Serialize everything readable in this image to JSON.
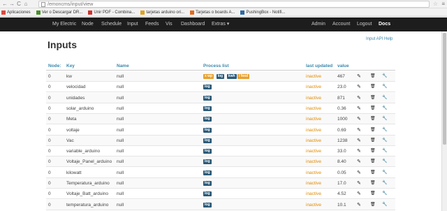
{
  "browser": {
    "url": "/emoncms/input/view",
    "bookmarks": [
      {
        "label": "Aplicaciones",
        "color": "#e5473c"
      },
      {
        "label": "Ver o Descargar DR...",
        "color": "#4a8f2a"
      },
      {
        "label": "Unir PDF - Combina...",
        "color": "#d1332e"
      },
      {
        "label": "tarjetas arduino ori...",
        "color": "#e0a21f"
      },
      {
        "label": "Tarjetas o boards A...",
        "color": "#e36a1e"
      },
      {
        "label": "PushingBox - Notifi...",
        "color": "#2c6aa8"
      }
    ]
  },
  "nav": {
    "items": [
      "My Electric",
      "Node",
      "Schedule",
      "Input",
      "Feeds",
      "Vis",
      "Dashboard",
      "Extras ▾"
    ],
    "right": [
      "Admin",
      "Account",
      "Logout",
      "Docs"
    ]
  },
  "page": {
    "title": "Inputs",
    "help_link": "Input API Help"
  },
  "table": {
    "headers": [
      "Node:",
      "Key",
      "Name",
      "Process list",
      "last updated",
      "value"
    ],
    "rows": [
      {
        "node": "0",
        "key": "kw",
        "name": "null",
        "process": [
          "x wp",
          "log",
          "kwh",
          "/ feed"
        ],
        "updated": "inactive",
        "value": "467"
      },
      {
        "node": "0",
        "key": "velocidad",
        "name": "null",
        "process": [
          "log"
        ],
        "updated": "inactive",
        "value": "23.0"
      },
      {
        "node": "0",
        "key": "unidades",
        "name": "null",
        "process": [
          "log"
        ],
        "updated": "inactive",
        "value": "871"
      },
      {
        "node": "0",
        "key": "solar_arduino",
        "name": "null",
        "process": [
          "log"
        ],
        "updated": "inactive",
        "value": "0.36"
      },
      {
        "node": "0",
        "key": "Meta",
        "name": "null",
        "process": [
          "log"
        ],
        "updated": "inactive",
        "value": "1000"
      },
      {
        "node": "0",
        "key": "voltaje",
        "name": "null",
        "process": [
          "log"
        ],
        "updated": "inactive",
        "value": "0.69"
      },
      {
        "node": "0",
        "key": "Vac",
        "name": "null",
        "process": [
          "log"
        ],
        "updated": "inactive",
        "value": "1238"
      },
      {
        "node": "0",
        "key": "variable_arduino",
        "name": "null",
        "process": [
          "log"
        ],
        "updated": "inactive",
        "value": "33.0"
      },
      {
        "node": "0",
        "key": "Voltaje_Panel_arduino",
        "name": "null",
        "process": [
          "log"
        ],
        "updated": "inactive",
        "value": "8.40"
      },
      {
        "node": "0",
        "key": "kilowatt",
        "name": "null",
        "process": [
          "log"
        ],
        "updated": "inactive",
        "value": "0.05"
      },
      {
        "node": "0",
        "key": "Temperatura_arduino",
        "name": "null",
        "process": [
          "log"
        ],
        "updated": "inactive",
        "value": "17.0"
      },
      {
        "node": "0",
        "key": "Voltaje_Batt_arduino",
        "name": "null",
        "process": [
          "log"
        ],
        "updated": "inactive",
        "value": "4.52"
      },
      {
        "node": "0",
        "key": "temperatura_arduino",
        "name": "null",
        "process": [
          "log"
        ],
        "updated": "inactive",
        "value": "10.1"
      }
    ]
  },
  "icons": {
    "edit": "pencil-icon",
    "delete": "trash-icon",
    "process": "wrench-icon"
  },
  "colors": {
    "navbar": "#1d1d1d",
    "header_text": "#3a87ad",
    "inactive": "#e08a00",
    "badge_log": "#2b5a78",
    "badge_x": "#e8a02c"
  }
}
